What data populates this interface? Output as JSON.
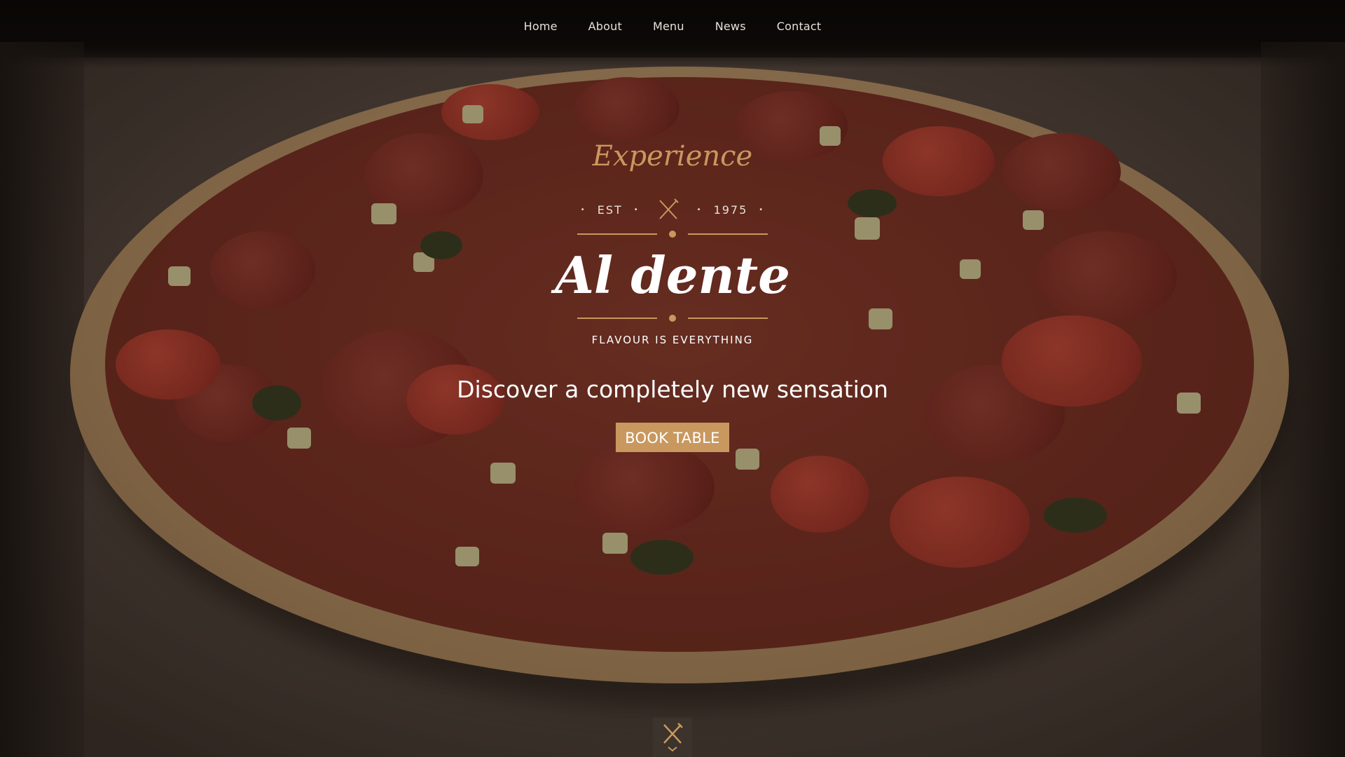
{
  "nav": {
    "items": [
      {
        "label": "Home"
      },
      {
        "label": "About"
      },
      {
        "label": "Menu"
      },
      {
        "label": "News"
      },
      {
        "label": "Contact"
      }
    ]
  },
  "hero": {
    "kicker": "Experience",
    "est_label": "EST",
    "est_year": "1975",
    "brand": "Al dente",
    "tagline": "FLAVOUR IS EVERYTHING",
    "headline": "Discover a completely new sensation",
    "cta_label": "BOOK TABLE",
    "icon": "cutlery-icon"
  },
  "scroll_button": {
    "icon": "cutlery-down-icon"
  },
  "colors": {
    "accent": "#c8985f",
    "text": "#ffffff",
    "nav_text": "#e8e1d8"
  }
}
